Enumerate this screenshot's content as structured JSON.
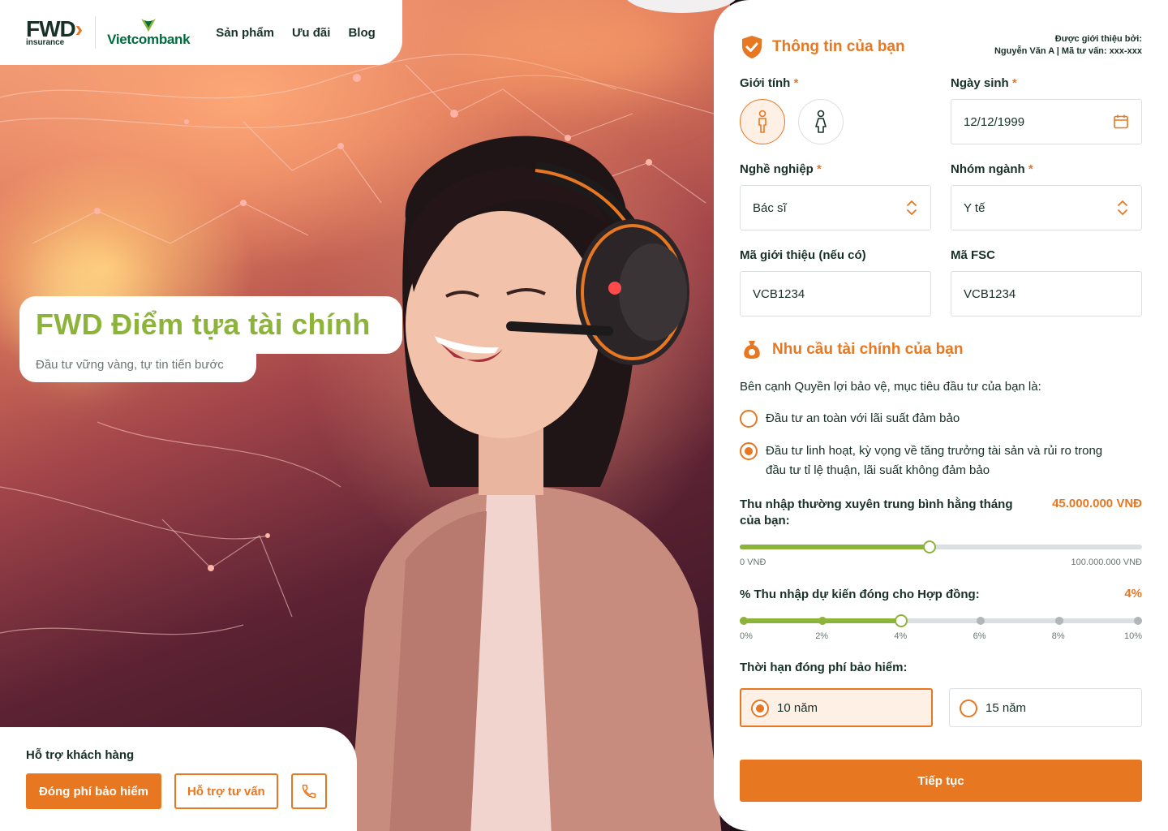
{
  "colors": {
    "orange": "#e87722",
    "green": "#8db43a",
    "dark": "#183028"
  },
  "nav": {
    "brand_main": "FWD",
    "brand_sub": "insurance",
    "partner": "Vietcombank",
    "links": [
      "Sản phẩm",
      "Ưu đãi",
      "Blog"
    ]
  },
  "hero": {
    "title": "FWD Điểm tựa tài chính",
    "subtitle": "Đầu tư vững vàng, tự tin tiến bước"
  },
  "support": {
    "title": "Hỗ trợ khách hàng",
    "pay_button": "Đóng phí bảo hiểm",
    "consult_button": "Hỗ trợ tư vấn",
    "phone_icon": "phone-icon"
  },
  "form": {
    "info_title": "Thông tin của bạn",
    "referrer_label": "Được giới thiệu bởi:",
    "referrer_value": "Nguyễn Văn A | Mã tư vấn: xxx-xxx",
    "gender_label": "Giới tính",
    "gender_selected": "male",
    "dob_label": "Ngày sinh",
    "dob_value": "12/12/1999",
    "job_label": "Nghề nghiệp",
    "job_value": "Bác sĩ",
    "industry_label": "Nhóm ngành",
    "industry_value": "Y tế",
    "ref_code_label": "Mã giới thiệu (nếu có)",
    "ref_code_value": "VCB1234",
    "fsc_label": "Mã FSC",
    "fsc_value": "VCB1234",
    "required_mark": "*",
    "needs_title": "Nhu cầu tài chính của bạn",
    "goal_question": "Bên cạnh Quyền lợi bảo vệ, mục tiêu đầu tư của bạn là:",
    "goal_options": [
      {
        "label_line1": "Đầu tư an toàn với lãi suất đảm bảo",
        "label_line2": "",
        "selected": false
      },
      {
        "label_line1": "Đầu tư linh hoạt, kỳ vọng về tăng trưởng tài sản và rủi ro trong",
        "label_line2": "đầu tư tỉ lệ thuận, lãi suất không đảm bảo",
        "selected": true
      }
    ],
    "income_label_line1": "Thu nhập thường xuyên trung bình hằng tháng",
    "income_label_line2": "của bạn:",
    "income_value": "45.000.000 VNĐ",
    "income_fraction": 0.45,
    "income_min": "0 VNĐ",
    "income_max": "100.000.000 VNĐ",
    "pct_label": "% Thu nhập dự kiến đóng cho Hợp đồng:",
    "pct_value": "4%",
    "pct_steps": [
      "0%",
      "2%",
      "4%",
      "6%",
      "8%",
      "10%"
    ],
    "pct_selected_index": 2,
    "term_label": "Thời hạn đóng phí bảo hiểm:",
    "term_options": [
      {
        "label": "10 năm",
        "selected": true
      },
      {
        "label": "15 năm",
        "selected": false
      }
    ],
    "continue_button": "Tiếp tục"
  }
}
